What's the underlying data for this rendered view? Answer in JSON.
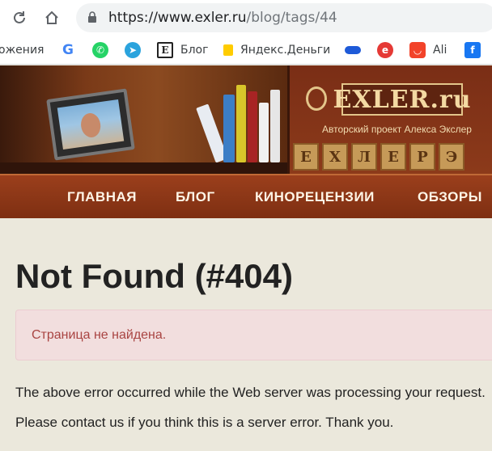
{
  "browser": {
    "url_host": "https://www.exler.ru",
    "url_path": "/blog/tags/44",
    "bookmarks": [
      {
        "label": "ожения",
        "icon": "folder-icon"
      },
      {
        "label": "",
        "icon": "google-icon",
        "color": "#4285f4"
      },
      {
        "label": "",
        "icon": "whatsapp-icon",
        "color": "#25d366"
      },
      {
        "label": "",
        "icon": "telegram-icon",
        "color": "#2aa3dd"
      },
      {
        "label": "Блог",
        "icon": "exler-icon",
        "color": "#222222"
      },
      {
        "label": "Яндекс.Деньги",
        "icon": "yandex-money-icon",
        "color": "#ffcc00"
      },
      {
        "label": "",
        "icon": "cloud-icon",
        "color": "#1e5ad8"
      },
      {
        "label": "",
        "icon": "circle-e-icon",
        "color": "#e53935"
      },
      {
        "label": "Ali",
        "icon": "aliexpress-icon",
        "color": "#f2432a"
      },
      {
        "label": "",
        "icon": "facebook-icon",
        "color": "#1877f2"
      }
    ]
  },
  "site": {
    "logo": "EXLER.ru",
    "tagline": "Авторский проект Алекса Экслер",
    "tiles": [
      "Е",
      "Х",
      "Л",
      "Е",
      "Р",
      "Э"
    ],
    "menu": [
      "ГЛАВНАЯ",
      "БЛОГ",
      "КИНОРЕЦЕНЗИИ",
      "ОБЗОРЫ"
    ],
    "accent": "#8c3a1a"
  },
  "error": {
    "title": "Not Found (#404)",
    "alert": "Страница не найдена.",
    "line1": "The above error occurred while the Web server was processing your request.",
    "line2": "Please contact us if you think this is a server error. Thank you."
  }
}
